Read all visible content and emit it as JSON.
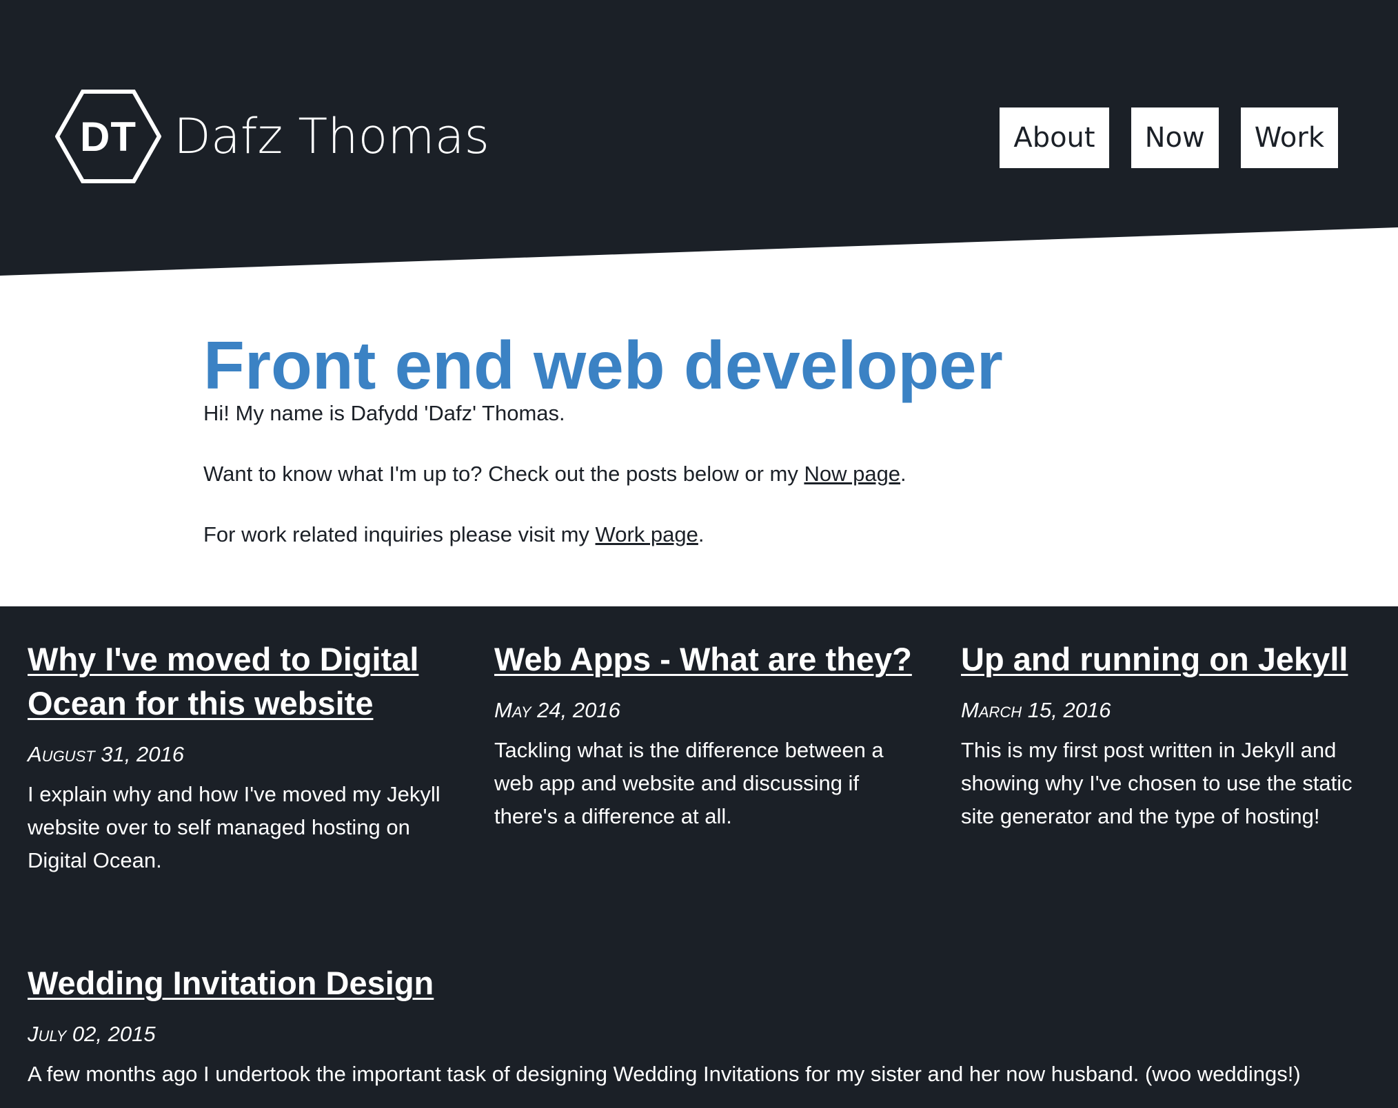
{
  "site": {
    "logo_initials": "DT",
    "name": "Dafz Thomas"
  },
  "nav": {
    "items": [
      {
        "label": "About"
      },
      {
        "label": "Now"
      },
      {
        "label": "Work"
      }
    ]
  },
  "intro": {
    "title": "Front end web developer",
    "greeting": "Hi! My name is Dafydd 'Dafz' Thomas.",
    "now_prefix": "Want to know what I'm up to? Check out the posts below or my ",
    "now_link": "Now page",
    "now_suffix": ".",
    "work_prefix": "For work related inquiries please visit my ",
    "work_link": "Work page",
    "work_suffix": "."
  },
  "posts": [
    {
      "title": "Why I've moved to Digital Ocean for this website",
      "date": "August 31, 2016",
      "excerpt": "I explain why and how I've moved my Jekyll website over to self managed hosting on Digital Ocean."
    },
    {
      "title": "Web Apps - What are they?",
      "date": "May 24, 2016",
      "excerpt": "Tackling what is the difference between a web app and website and discussing if there's a difference at all."
    },
    {
      "title": "Up and running on Jekyll",
      "date": "March 15, 2016",
      "excerpt": "This is my first post written in Jekyll and showing why I've chosen to use the static site generator and the type of hosting!"
    },
    {
      "title": "Wedding Invitation Design",
      "date": "July 02, 2015",
      "excerpt": "A few months ago I undertook the important task of designing Wedding Invitations for my sister and her now husband. (woo weddings!)"
    }
  ],
  "colors": {
    "dark_background": "#1b2027",
    "light_background": "#ffffff",
    "accent_blue": "#3b82c4"
  }
}
